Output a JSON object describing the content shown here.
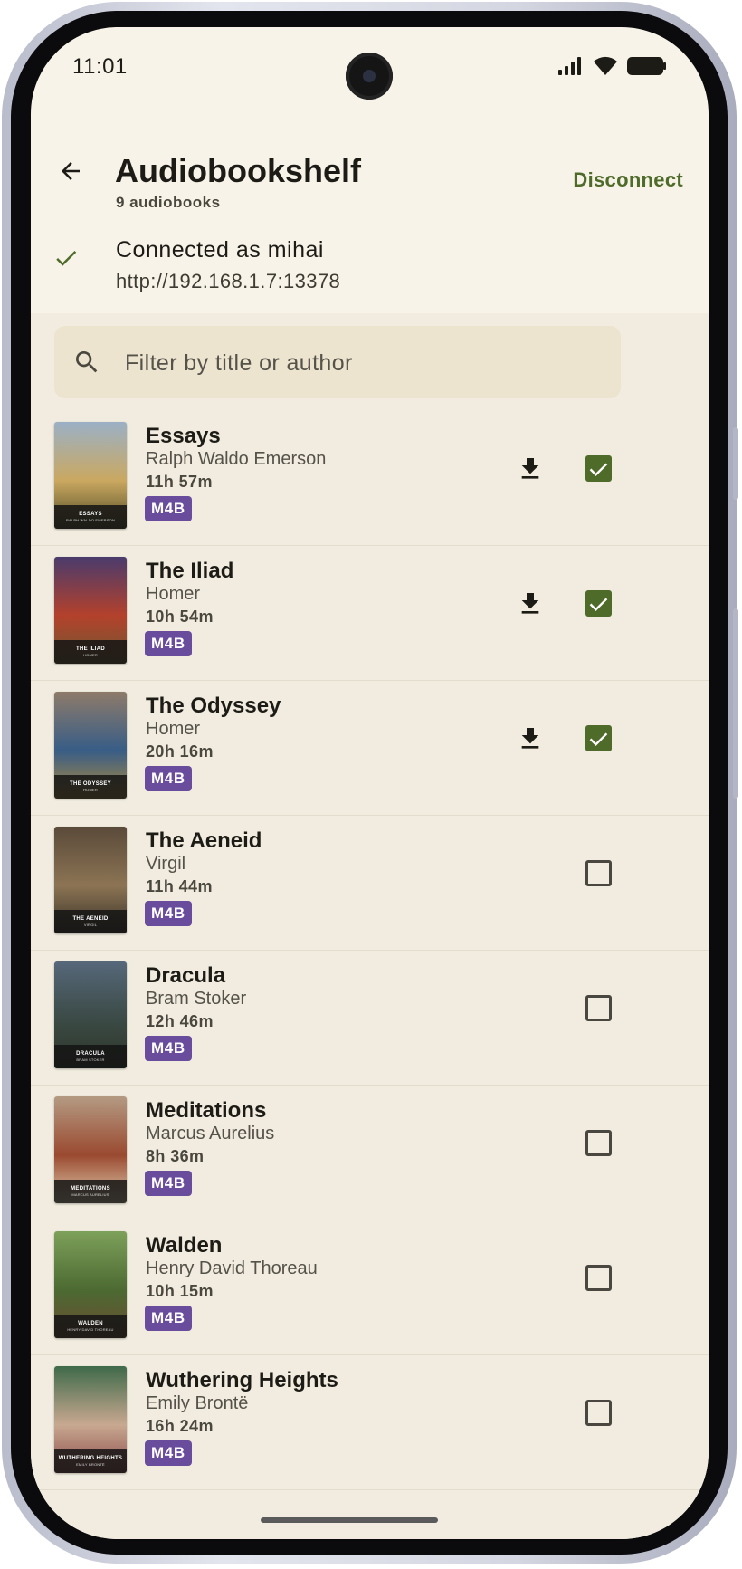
{
  "status_bar": {
    "time": "11:01"
  },
  "app_bar": {
    "title": "Audiobookshelf",
    "subtitle": "9 audiobooks",
    "disconnect_label": "Disconnect"
  },
  "connection": {
    "user_text": "Connected as mihai",
    "server_url": "http://192.168.1.7:13378"
  },
  "search": {
    "placeholder": "Filter by title or author",
    "value": ""
  },
  "colors": {
    "accent": "#4e6b2a",
    "badge": "#6a4c9c",
    "background": "#f7f3e8",
    "list_background": "#f1ecdf"
  },
  "books": [
    {
      "title": "Essays",
      "author": "Ralph Waldo Emerson",
      "duration": "11h 57m",
      "format": "M4B",
      "downloaded": true,
      "selected": true,
      "cover_title": "ESSAYS",
      "cover_author": "RALPH WALDO EMERSON",
      "cover_top": "#9bb0c6",
      "cover_mid": "#caa860",
      "cover_bottom": "#4e4a25"
    },
    {
      "title": "The Iliad",
      "author": "Homer",
      "duration": "10h 54m",
      "format": "M4B",
      "downloaded": true,
      "selected": true,
      "cover_title": "THE ILIAD",
      "cover_author": "HOMER",
      "cover_top": "#4a3b6d",
      "cover_mid": "#b4412c",
      "cover_bottom": "#6f5a30"
    },
    {
      "title": "The Odyssey",
      "author": "Homer",
      "duration": "20h 16m",
      "format": "M4B",
      "downloaded": true,
      "selected": true,
      "cover_title": "THE ODYSSEY",
      "cover_author": "HOMER",
      "cover_top": "#8e7b6a",
      "cover_mid": "#385d86",
      "cover_bottom": "#b08a3e"
    },
    {
      "title": "The Aeneid",
      "author": "Virgil",
      "duration": "11h 44m",
      "format": "M4B",
      "downloaded": false,
      "selected": false,
      "cover_title": "THE AENEID",
      "cover_author": "VIRGIL",
      "cover_top": "#5a4a3a",
      "cover_mid": "#8c7454",
      "cover_bottom": "#3a3328"
    },
    {
      "title": "Dracula",
      "author": "Bram Stoker",
      "duration": "12h 46m",
      "format": "M4B",
      "downloaded": false,
      "selected": false,
      "cover_title": "DRACULA",
      "cover_author": "BRAM STOKER",
      "cover_top": "#56687a",
      "cover_mid": "#3b4a45",
      "cover_bottom": "#2c3528"
    },
    {
      "title": "Meditations",
      "author": "Marcus Aurelius",
      "duration": "8h 36m",
      "format": "M4B",
      "downloaded": false,
      "selected": false,
      "cover_title": "MEDITATIONS",
      "cover_author": "MARCUS AURELIUS",
      "cover_top": "#b49a82",
      "cover_mid": "#9a4a30",
      "cover_bottom": "#e0cfb0"
    },
    {
      "title": "Walden",
      "author": "Henry David Thoreau",
      "duration": "10h 15m",
      "format": "M4B",
      "downloaded": false,
      "selected": false,
      "cover_title": "WALDEN",
      "cover_author": "HENRY DAVID THOREAU",
      "cover_top": "#7da05a",
      "cover_mid": "#4c6a32",
      "cover_bottom": "#6a4c30"
    },
    {
      "title": "Wuthering Heights",
      "author": "Emily Brontë",
      "duration": "16h 24m",
      "format": "M4B",
      "downloaded": false,
      "selected": false,
      "cover_title": "WUTHERING HEIGHTS",
      "cover_author": "EMILY BRONTË",
      "cover_top": "#3f6a4a",
      "cover_mid": "#c8a890",
      "cover_bottom": "#8a4a4a"
    }
  ]
}
